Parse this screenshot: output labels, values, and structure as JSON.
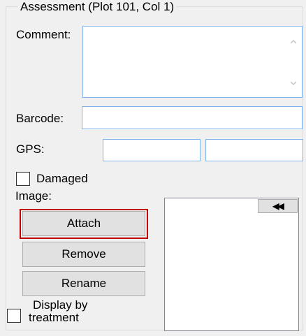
{
  "assessment": {
    "group_title": "Assessment (Plot 101, Col  1)",
    "comment_label": "Comment:",
    "comment_value": "",
    "barcode_label": "Barcode:",
    "barcode_value": "",
    "gps_label": "GPS:",
    "gps_lat_value": "",
    "gps_lon_value": "",
    "damaged_label": "Damaged",
    "damaged_checked": false,
    "image_label": "Image:",
    "buttons": {
      "attach": "Attach",
      "remove": "Remove",
      "rename": "Rename"
    },
    "image_nav_glyph": "◀◀",
    "display_by_treatment_line1": "Display by",
    "display_by_treatment_line2": "treatment",
    "display_by_treatment_checked": false
  },
  "colors": {
    "highlight": "#c00000",
    "focus_border": "#7eb4ea"
  },
  "icons": {
    "comment_scroll_up": "chevron-up-icon",
    "comment_scroll_down": "chevron-down-icon",
    "image_nav": "double-left-arrow-icon"
  }
}
